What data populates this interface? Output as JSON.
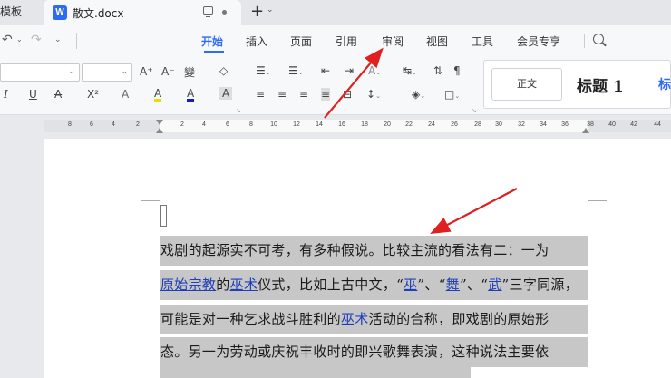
{
  "tabs": {
    "prev_label": "模板",
    "active_title": "散文.docx",
    "word_icon": "W",
    "new_tab": "+",
    "new_tab_caret": "⌄"
  },
  "menu": {
    "items": [
      "开始",
      "插入",
      "页面",
      "引用",
      "审阅",
      "视图",
      "工具",
      "会员专享"
    ],
    "active": "开始"
  },
  "ribbon": {
    "font_grow": "A⁺",
    "font_shrink": "A⁻",
    "phonetic": "變",
    "clear_format": "◇",
    "italic": "I",
    "underline": "U",
    "strike": "A",
    "superscript": "X²",
    "text_effect": "A",
    "highlight": "A",
    "font_color": "A",
    "char_shade": "A",
    "styles": {
      "normal": "正文",
      "heading1": "标题 1",
      "heading2": "标"
    }
  },
  "ruler": {
    "numbers": [
      "8",
      "6",
      "4",
      "2",
      "2",
      "4",
      "6",
      "8",
      "10",
      "12",
      "14",
      "16",
      "18",
      "20",
      "22",
      "24",
      "26",
      "28",
      "30",
      "32",
      "34",
      "36",
      "38",
      "40",
      "42",
      "44"
    ]
  },
  "document": {
    "lines": [
      [
        {
          "t": "戏剧的起源实不可考，有多种假说。比较主流的看法有二：一为",
          "link": false
        }
      ],
      [
        {
          "t": "原始宗教",
          "link": true
        },
        {
          "t": "的",
          "link": false
        },
        {
          "t": "巫术",
          "link": true
        },
        {
          "t": "仪式，比如上古中文，“",
          "link": false
        },
        {
          "t": "巫",
          "link": true
        },
        {
          "t": "”、“",
          "link": false
        },
        {
          "t": "舞",
          "link": true
        },
        {
          "t": "”、“",
          "link": false
        },
        {
          "t": "武",
          "link": true
        },
        {
          "t": "”三字同源，",
          "link": false
        }
      ],
      [
        {
          "t": "可能是对一种乞求战斗胜利的",
          "link": false
        },
        {
          "t": "巫术",
          "link": true
        },
        {
          "t": "活动的合称，即戏剧的原始形",
          "link": false
        }
      ],
      [
        {
          "t": "态。另一为劳动或庆祝丰收时的即兴歌舞表演，这种说法主要依",
          "link": false
        }
      ]
    ]
  },
  "colors": {
    "accent": "#2f6bf2",
    "link": "#1f3fb8",
    "selection": "#c7c7c7",
    "arrow": "#e02020"
  }
}
